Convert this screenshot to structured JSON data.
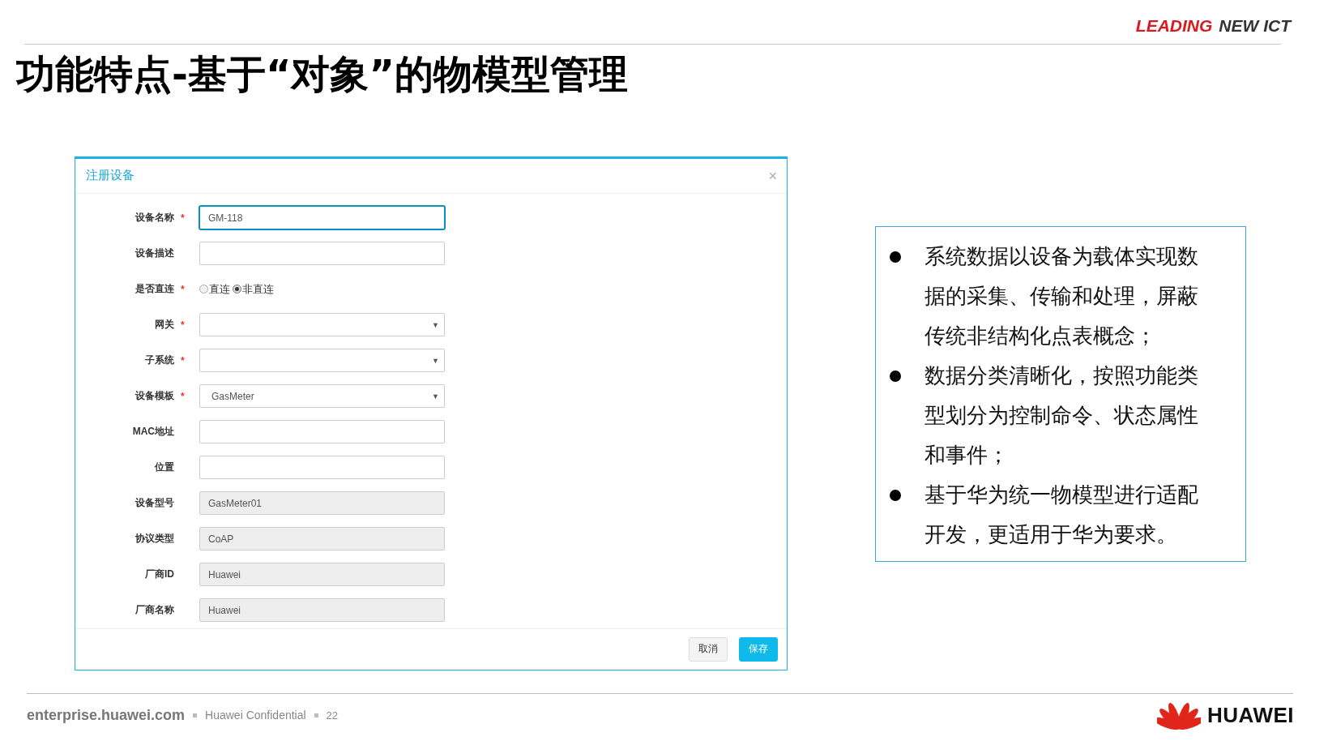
{
  "header": {
    "tagline": [
      {
        "text": "LEADING",
        "kind": "accent"
      },
      {
        "text": "NEW ICT",
        "kind": "plain"
      }
    ]
  },
  "title": "功能特点-基于“对象”的物模型管理",
  "dialog": {
    "title": "注册设备",
    "close": "×",
    "required_mark": "*",
    "dropdown_caret": "▼",
    "fields": [
      {
        "label": "设备名称",
        "required": true,
        "kind": "text",
        "value": "GM-118",
        "focused": true
      },
      {
        "label": "设备描述",
        "required": false,
        "kind": "text",
        "focused": false
      },
      {
        "label": "是否直连",
        "required": true,
        "kind": "radio",
        "focused": false,
        "options": [
          {
            "label": "直连",
            "selected": false
          },
          {
            "label": "非直连",
            "selected": true
          }
        ]
      },
      {
        "label": "网关",
        "required": true,
        "kind": "select",
        "focused": false
      },
      {
        "label": "子系统",
        "required": true,
        "kind": "select",
        "focused": false
      },
      {
        "label": "设备模板",
        "required": true,
        "kind": "select",
        "value": "GasMeter",
        "focused": false
      },
      {
        "label": "MAC地址",
        "required": false,
        "kind": "text",
        "focused": false
      },
      {
        "label": "位置",
        "required": false,
        "kind": "text",
        "focused": false
      },
      {
        "label": "设备型号",
        "required": false,
        "kind": "readonly",
        "value": "GasMeter01",
        "focused": false
      },
      {
        "label": "协议类型",
        "required": false,
        "kind": "readonly",
        "value": "CoAP",
        "focused": false
      },
      {
        "label": "厂商ID",
        "required": false,
        "kind": "readonly",
        "value": "Huawei",
        "focused": false
      },
      {
        "label": "厂商名称",
        "required": false,
        "kind": "readonly",
        "value": "Huawei",
        "focused": false
      }
    ],
    "buttons": [
      {
        "label": "取消",
        "kind": "default"
      },
      {
        "label": "保存",
        "kind": "primary"
      }
    ]
  },
  "bullets": [
    "系统数据以设备为载体实现数据的采集、传输和处理，屏蔽传统非结构化点表概念；",
    "数据分类清晰化，按照功能类型划分为控制命令、状态属性和事件；",
    "基于华为统一物模型进行适配开发，更适用于华为要求。"
  ],
  "footer": {
    "site": "enterprise.huawei.com",
    "confidential": "Huawei Confidential",
    "page": "22",
    "brand": "HUAWEI"
  }
}
